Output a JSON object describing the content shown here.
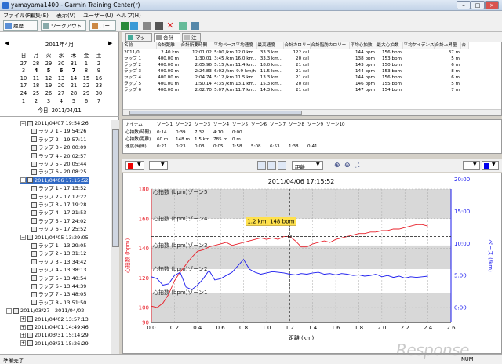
{
  "window": {
    "title": "yamayama1400 - Garmin Training Center(r)"
  },
  "menu": [
    "ファイル(F)",
    "編集(E)",
    "表示(V)",
    "ユーザー(U)",
    "ヘルプ(H)"
  ],
  "toolbar": {
    "history": "履歴",
    "workouts": "ワークアウト",
    "courses": "コース"
  },
  "calendar": {
    "month": "2011年4月",
    "weekdays": [
      "日",
      "月",
      "火",
      "水",
      "木",
      "金",
      "土"
    ],
    "weeks": [
      [
        "27",
        "28",
        "29",
        "30",
        "31",
        "1",
        "2"
      ],
      [
        "3",
        "4",
        "5",
        "6",
        "7",
        "8",
        "9"
      ],
      [
        "10",
        "11",
        "12",
        "13",
        "14",
        "15",
        "16"
      ],
      [
        "17",
        "18",
        "19",
        "20",
        "21",
        "22",
        "23"
      ],
      [
        "24",
        "25",
        "26",
        "27",
        "28",
        "29",
        "30"
      ],
      [
        "1",
        "2",
        "3",
        "4",
        "5",
        "6",
        "7"
      ]
    ],
    "today": "今日: 2011/04/11"
  },
  "tree": [
    {
      "label": "2011/04/07 19:54:26",
      "level": 1,
      "sign": "−"
    },
    {
      "label": "ラップ 1 - 19:54:26",
      "level": 2
    },
    {
      "label": "ラップ 2 - 19:57:11",
      "level": 2
    },
    {
      "label": "ラップ 3 - 20:00:09",
      "level": 2
    },
    {
      "label": "ラップ 4 - 20:02:57",
      "level": 2
    },
    {
      "label": "ラップ 5 - 20:05:44",
      "level": 2
    },
    {
      "label": "ラップ 6 - 20:08:25",
      "level": 2
    },
    {
      "label": "2011/04/06 17:15:52",
      "level": 1,
      "sign": "−",
      "selected": true
    },
    {
      "label": "ラップ 1 - 17:15:52",
      "level": 2
    },
    {
      "label": "ラップ 2 - 17:17:22",
      "level": 2
    },
    {
      "label": "ラップ 3 - 17:19:28",
      "level": 2
    },
    {
      "label": "ラップ 4 - 17:21:53",
      "level": 2
    },
    {
      "label": "ラップ 5 - 17:24:02",
      "level": 2
    },
    {
      "label": "ラップ 6 - 17:25:52",
      "level": 2
    },
    {
      "label": "2011/04/05 13:29:05",
      "level": 1,
      "sign": "−"
    },
    {
      "label": "ラップ 1 - 13:29:05",
      "level": 2
    },
    {
      "label": "ラップ 2 - 13:31:12",
      "level": 2
    },
    {
      "label": "ラップ 3 - 13:34:42",
      "level": 2
    },
    {
      "label": "ラップ 4 - 13:38:13",
      "level": 2
    },
    {
      "label": "ラップ 5 - 13:40:54",
      "level": 2
    },
    {
      "label": "ラップ 6 - 13:44:39",
      "level": 2
    },
    {
      "label": "ラップ 7 - 13:48:05",
      "level": 2
    },
    {
      "label": "ラップ 8 - 13:51:50",
      "level": 2
    },
    {
      "label": "2011/03/27 - 2011/04/02",
      "level": 0,
      "sign": "−"
    },
    {
      "label": "2011/04/02 13:57:13",
      "level": 1,
      "sign": "+"
    },
    {
      "label": "2011/04/01 14:49:46",
      "level": 1,
      "sign": "+"
    },
    {
      "label": "2011/03/31 15:14:29",
      "level": 1,
      "sign": "+"
    },
    {
      "label": "2011/03/31 15:26:29",
      "level": 1,
      "sign": "+"
    }
  ],
  "tabs": [
    "マップ",
    "合計",
    "注"
  ],
  "laps": {
    "headers": [
      "名前",
      "合計距離",
      "合計所要時間",
      "平均ペース",
      "平均速度",
      "最高速度",
      "合計カロリー",
      "合計脂肪カロリー",
      "平均心拍数",
      "最大心拍数",
      "平均ケイデンス",
      "合計上昇量",
      "合"
    ],
    "rows": [
      [
        "2011/0...",
        "2.40 km",
        "12:01.02",
        "5:00 /km",
        "12.0 km...",
        "33.3 km...",
        "122 cal",
        "",
        "144 bpm",
        "156 bpm",
        "",
        "37 m",
        ""
      ],
      [
        "ラップ 1",
        "400.00 m",
        "1:30.01",
        "3:45 /km",
        "16.0 km...",
        "33.3 km...",
        "20 cal",
        "",
        "138 bpm",
        "153 bpm",
        "",
        "5 m",
        ""
      ],
      [
        "ラップ 2",
        "400.00 m",
        "2:05.96",
        "5:15 /km",
        "11.4 km...",
        "18.0 km...",
        "21 cal",
        "",
        "143 bpm",
        "150 bpm",
        "",
        "6 m",
        ""
      ],
      [
        "ラップ 3",
        "400.00 m",
        "2:24.83",
        "6:02 /km",
        "9.9 km/h",
        "11.5 km...",
        "21 cal",
        "",
        "144 bpm",
        "153 bpm",
        "",
        "8 m",
        ""
      ],
      [
        "ラップ 4",
        "400.00 m",
        "2:04.74",
        "5:12 /km",
        "11.5 km...",
        "13.3 km...",
        "21 cal",
        "",
        "144 bpm",
        "156 bpm",
        "",
        "6 m",
        ""
      ],
      [
        "ラップ 5",
        "400.00 m",
        "1:50.14",
        "4:35 /km",
        "13.1 km...",
        "15.3 km...",
        "20 cal",
        "",
        "146 bpm",
        "155 bpm",
        "",
        "5 m",
        ""
      ],
      [
        "ラップ 6",
        "400.00 m",
        "2:02.70",
        "5:07 /km",
        "11.7 km...",
        "14.3 km...",
        "21 cal",
        "",
        "147 bpm",
        "154 bpm",
        "",
        "7 m",
        ""
      ]
    ]
  },
  "zones": {
    "headers": [
      "アイテム",
      "ゾーン1",
      "ゾーン2",
      "ゾーン3",
      "ゾーン4",
      "ゾーン5",
      "ゾーン6",
      "ゾーン7",
      "ゾーン8",
      "ゾーン9",
      "ゾーン10"
    ],
    "rows": [
      [
        "心拍数(時間)",
        "0:14",
        "0:39",
        "7:32",
        "4:10",
        "0:00",
        "",
        "",
        "",
        "",
        ""
      ],
      [
        "心拍数(距離)",
        "60 m",
        "148 m",
        "1.5 km",
        "785 m",
        "0 m",
        "",
        "",
        "",
        "",
        ""
      ],
      [
        "速度(時間)",
        "0:21",
        "0:23",
        "0:03",
        "0:05",
        "1:58",
        "5:08",
        "6:53",
        "1:38",
        "0:41",
        ""
      ]
    ]
  },
  "chart_controls": {
    "distance_select": "距離"
  },
  "chart_data": {
    "type": "line",
    "title": "2011/04/06 17:15:52",
    "xlabel": "距離 (km)",
    "ylabel": "心拍数 (bpm)",
    "ylabel2": "ペース (/km)",
    "xlim": [
      0,
      2.6
    ],
    "xticks": [
      "0.0",
      "0.2",
      "0.4",
      "0.6",
      "0.8",
      "1.0",
      "1.2",
      "1.4",
      "1.6",
      "1.8",
      "2.0",
      "2.2",
      "2.4",
      "2.6"
    ],
    "ylim": [
      90,
      180
    ],
    "yticks": [
      "90",
      "100",
      "120",
      "140",
      "160",
      "180"
    ],
    "y2ticks": [
      "0:00",
      "5:00",
      "10:00",
      "15:00",
      "20:00"
    ],
    "zones": [
      {
        "label": "心拍数 (bpm)ゾーン5",
        "y": 178
      },
      {
        "label": "心拍数 (bpm)ゾーン4",
        "y": 160
      },
      {
        "label": "心拍数 (bpm)ゾーン3",
        "y": 142
      },
      {
        "label": "心拍数 (bpm)ゾーン2",
        "y": 126
      },
      {
        "label": "心拍数 (bpm)ゾーン1",
        "y": 110
      }
    ],
    "tooltip": "1.2 km, 148 bpm",
    "cursor": {
      "x": 1.2,
      "y": 148
    },
    "series": [
      {
        "axis": "left",
        "color": "#e8202a",
        "x": [
          0,
          0.05,
          0.1,
          0.15,
          0.2,
          0.25,
          0.3,
          0.35,
          0.4,
          0.45,
          0.5,
          0.55,
          0.6,
          0.65,
          0.7,
          0.75,
          0.8,
          0.85,
          0.9,
          0.95,
          1.0,
          1.05,
          1.1,
          1.15,
          1.2,
          1.25,
          1.3,
          1.35,
          1.4,
          1.45,
          1.5,
          1.55,
          1.6,
          1.65,
          1.7,
          1.75,
          1.8,
          1.85,
          1.9,
          1.95,
          2.0,
          2.05,
          2.1,
          2.15,
          2.2,
          2.25,
          2.3,
          2.35,
          2.4
        ],
        "values": [
          101,
          100,
          103,
          109,
          118,
          124,
          129,
          134,
          138,
          139,
          141,
          142,
          143,
          144,
          142,
          143,
          144,
          145,
          146,
          147,
          146,
          147,
          146,
          148,
          148,
          145,
          141,
          141,
          143,
          144,
          145,
          144,
          146,
          147,
          148,
          149,
          150,
          150,
          151,
          151,
          152,
          152,
          153,
          153,
          154,
          155,
          156,
          156,
          155
        ]
      },
      {
        "axis": "right",
        "color": "#1a1aee",
        "x": [
          0,
          0.05,
          0.1,
          0.15,
          0.2,
          0.25,
          0.3,
          0.35,
          0.4,
          0.45,
          0.5,
          0.55,
          0.6,
          0.65,
          0.7,
          0.75,
          0.8,
          0.85,
          0.9,
          0.95,
          1.0,
          1.05,
          1.1,
          1.15,
          1.2,
          1.25,
          1.3,
          1.35,
          1.4,
          1.45,
          1.5,
          1.55,
          1.6,
          1.65,
          1.7,
          1.75,
          1.8,
          1.85,
          1.9,
          1.95,
          2.0,
          2.05,
          2.1,
          2.15,
          2.2,
          2.25,
          2.3,
          2.35,
          2.4
        ],
        "values": [
          4.8,
          4.5,
          3.5,
          3.7,
          5.0,
          5.5,
          3.2,
          2.8,
          3.5,
          4.5,
          5.8,
          4.3,
          4.5,
          5.0,
          5.5,
          6.5,
          7.5,
          6.0,
          5.5,
          5.2,
          5.4,
          5.6,
          5.5,
          5.4,
          5.2,
          5.1,
          5.3,
          5.2,
          5.4,
          5.5,
          5.2,
          5.3,
          5.1,
          5.3,
          5.2,
          5.0,
          5.1,
          4.9,
          5.0,
          5.2,
          4.8,
          5.0,
          4.7,
          4.9,
          4.6,
          4.8,
          4.7,
          4.8,
          4.9
        ]
      }
    ]
  },
  "status": {
    "left": "準備完了",
    "right": "NUM"
  },
  "watermark": "Response."
}
